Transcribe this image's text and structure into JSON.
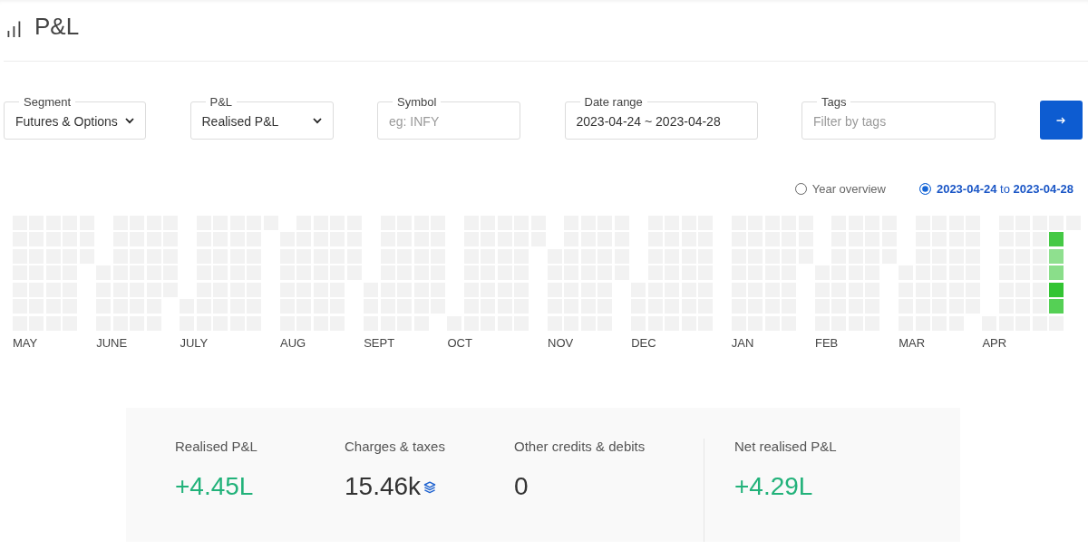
{
  "page": {
    "title": "P&L"
  },
  "filters": [
    {
      "kind": "select",
      "label": "Segment",
      "value": "Futures & Options"
    },
    {
      "kind": "select",
      "label": "P&L",
      "value": "Realised P&L"
    },
    {
      "kind": "input",
      "label": "Symbol",
      "placeholder": "eg: INFY"
    },
    {
      "kind": "input",
      "label": "Date range",
      "value": "2023-04-24 ~ 2023-04-28"
    },
    {
      "kind": "input",
      "label": "Tags",
      "placeholder": "Filter by tags"
    }
  ],
  "view_options": [
    {
      "label": "Year overview",
      "selected": false
    },
    {
      "label": "**2023-04-24** to **2023-04-28**",
      "selected": true
    }
  ],
  "heatmap": {
    "months": [
      {
        "label": "MAY",
        "days": [
          {
            "color": "#f2f2f2"
          },
          {
            "color": "#f2f2f2"
          },
          {
            "color": "#f2f2f2"
          },
          {
            "color": "#f2f2f2"
          },
          {
            "color": "#f2f2f2"
          },
          {
            "color": "#f2f2f2"
          },
          {
            "color": "#f2f2f2"
          },
          {
            "color": "#f2f2f2"
          },
          {
            "color": "#f2f2f2"
          },
          {
            "color": "#f2f2f2"
          },
          {
            "color": "#f2f2f2"
          },
          {
            "color": "#f2f2f2"
          },
          {
            "color": "#f2f2f2"
          },
          {
            "color": "#f2f2f2"
          },
          {
            "color": "#f2f2f2"
          },
          {
            "color": "#f2f2f2"
          },
          {
            "color": "#f2f2f2"
          },
          {
            "color": "#f2f2f2"
          },
          {
            "color": "#f2f2f2"
          },
          {
            "color": "#f2f2f2"
          },
          {
            "color": "#f2f2f2"
          },
          {
            "color": "#f2f2f2"
          },
          {
            "color": "#f2f2f2"
          },
          {
            "color": "#f2f2f2"
          },
          {
            "color": "#f2f2f2"
          },
          {
            "color": "#f2f2f2"
          },
          {
            "color": "#f2f2f2"
          },
          {
            "color": "#f2f2f2"
          },
          {
            "color": "#f2f2f2"
          },
          {
            "color": "#f2f2f2"
          },
          {
            "color": "#f2f2f2"
          }
        ]
      },
      {
        "label": "JUNE",
        "days": [
          {
            "color": "#f2f2f2"
          },
          {
            "color": "#f2f2f2"
          },
          {
            "color": "#f2f2f2"
          },
          {
            "color": "#f2f2f2"
          },
          {
            "color": "#f2f2f2"
          },
          {
            "color": "#f2f2f2"
          },
          {
            "color": "#f2f2f2"
          },
          {
            "color": "#f2f2f2"
          },
          {
            "color": "#f2f2f2"
          },
          {
            "color": "#f2f2f2"
          },
          {
            "color": "#f2f2f2"
          },
          {
            "color": "#f2f2f2"
          },
          {
            "color": "#f2f2f2"
          },
          {
            "color": "#f2f2f2"
          },
          {
            "color": "#f2f2f2"
          },
          {
            "color": "#f2f2f2"
          },
          {
            "color": "#f2f2f2"
          },
          {
            "color": "#f2f2f2"
          },
          {
            "color": "#f2f2f2"
          },
          {
            "color": "#f2f2f2"
          },
          {
            "color": "#f2f2f2"
          },
          {
            "color": "#f2f2f2"
          },
          {
            "color": "#f2f2f2"
          },
          {
            "color": "#f2f2f2"
          },
          {
            "color": "#f2f2f2"
          },
          {
            "color": "#f2f2f2"
          },
          {
            "color": "#f2f2f2"
          },
          {
            "color": "#f2f2f2"
          },
          {
            "color": "#f2f2f2"
          },
          {
            "color": "#f2f2f2"
          }
        ]
      },
      {
        "label": "JULY",
        "days": [
          {
            "color": "#f2f2f2"
          },
          {
            "color": "#f2f2f2"
          },
          {
            "color": "#f2f2f2"
          },
          {
            "color": "#f2f2f2"
          },
          {
            "color": "#f2f2f2"
          },
          {
            "color": "#f2f2f2"
          },
          {
            "color": "#f2f2f2"
          },
          {
            "color": "#f2f2f2"
          },
          {
            "color": "#f2f2f2"
          },
          {
            "color": "#f2f2f2"
          },
          {
            "color": "#f2f2f2"
          },
          {
            "color": "#f2f2f2"
          },
          {
            "color": "#f2f2f2"
          },
          {
            "color": "#f2f2f2"
          },
          {
            "color": "#f2f2f2"
          },
          {
            "color": "#f2f2f2"
          },
          {
            "color": "#f2f2f2"
          },
          {
            "color": "#f2f2f2"
          },
          {
            "color": "#f2f2f2"
          },
          {
            "color": "#f2f2f2"
          },
          {
            "color": "#f2f2f2"
          },
          {
            "color": "#f2f2f2"
          },
          {
            "color": "#f2f2f2"
          },
          {
            "color": "#f2f2f2"
          },
          {
            "color": "#f2f2f2"
          },
          {
            "color": "#f2f2f2"
          },
          {
            "color": "#f2f2f2"
          },
          {
            "color": "#f2f2f2"
          },
          {
            "color": "#f2f2f2"
          },
          {
            "color": "#f2f2f2"
          },
          {
            "color": "#f2f2f2"
          }
        ]
      },
      {
        "label": "AUG",
        "days": [
          {
            "color": "#f2f2f2"
          },
          {
            "color": "#f2f2f2"
          },
          {
            "color": "#f2f2f2"
          },
          {
            "color": "#f2f2f2"
          },
          {
            "color": "#f2f2f2"
          },
          {
            "color": "#f2f2f2"
          },
          {
            "color": "#f2f2f2"
          },
          {
            "color": "#f2f2f2"
          },
          {
            "color": "#f2f2f2"
          },
          {
            "color": "#f2f2f2"
          },
          {
            "color": "#f2f2f2"
          },
          {
            "color": "#f2f2f2"
          },
          {
            "color": "#f2f2f2"
          },
          {
            "color": "#f2f2f2"
          },
          {
            "color": "#f2f2f2"
          },
          {
            "color": "#f2f2f2"
          },
          {
            "color": "#f2f2f2"
          },
          {
            "color": "#f2f2f2"
          },
          {
            "color": "#f2f2f2"
          },
          {
            "color": "#f2f2f2"
          },
          {
            "color": "#f2f2f2"
          },
          {
            "color": "#f2f2f2"
          },
          {
            "color": "#f2f2f2"
          },
          {
            "color": "#f2f2f2"
          },
          {
            "color": "#f2f2f2"
          },
          {
            "color": "#f2f2f2"
          },
          {
            "color": "#f2f2f2"
          },
          {
            "color": "#f2f2f2"
          },
          {
            "color": "#f2f2f2"
          },
          {
            "color": "#f2f2f2"
          },
          {
            "color": "#f2f2f2"
          }
        ]
      },
      {
        "label": "SEPT",
        "days": [
          {
            "color": "#f2f2f2"
          },
          {
            "color": "#f2f2f2"
          },
          {
            "color": "#f2f2f2"
          },
          {
            "color": "#f2f2f2"
          },
          {
            "color": "#f2f2f2"
          },
          {
            "color": "#f2f2f2"
          },
          {
            "color": "#f2f2f2"
          },
          {
            "color": "#f2f2f2"
          },
          {
            "color": "#f2f2f2"
          },
          {
            "color": "#f2f2f2"
          },
          {
            "color": "#f2f2f2"
          },
          {
            "color": "#f2f2f2"
          },
          {
            "color": "#f2f2f2"
          },
          {
            "color": "#f2f2f2"
          },
          {
            "color": "#f2f2f2"
          },
          {
            "color": "#f2f2f2"
          },
          {
            "color": "#f2f2f2"
          },
          {
            "color": "#f2f2f2"
          },
          {
            "color": "#f2f2f2"
          },
          {
            "color": "#f2f2f2"
          },
          {
            "color": "#f2f2f2"
          },
          {
            "color": "#f2f2f2"
          },
          {
            "color": "#f2f2f2"
          },
          {
            "color": "#f2f2f2"
          },
          {
            "color": "#f2f2f2"
          },
          {
            "color": "#f2f2f2"
          },
          {
            "color": "#f2f2f2"
          },
          {
            "color": "#f2f2f2"
          },
          {
            "color": "#f2f2f2"
          },
          {
            "color": "#f2f2f2"
          }
        ]
      },
      {
        "label": "OCT",
        "days": [
          {
            "color": "#f2f2f2"
          },
          {
            "color": "#f2f2f2"
          },
          {
            "color": "#f2f2f2"
          },
          {
            "color": "#f2f2f2"
          },
          {
            "color": "#f2f2f2"
          },
          {
            "color": "#f2f2f2"
          },
          {
            "color": "#f2f2f2"
          },
          {
            "color": "#f2f2f2"
          },
          {
            "color": "#f2f2f2"
          },
          {
            "color": "#f2f2f2"
          },
          {
            "color": "#f2f2f2"
          },
          {
            "color": "#f2f2f2"
          },
          {
            "color": "#f2f2f2"
          },
          {
            "color": "#f2f2f2"
          },
          {
            "color": "#f2f2f2"
          },
          {
            "color": "#f2f2f2"
          },
          {
            "color": "#f2f2f2"
          },
          {
            "color": "#f2f2f2"
          },
          {
            "color": "#f2f2f2"
          },
          {
            "color": "#f2f2f2"
          },
          {
            "color": "#f2f2f2"
          },
          {
            "color": "#f2f2f2"
          },
          {
            "color": "#f2f2f2"
          },
          {
            "color": "#f2f2f2"
          },
          {
            "color": "#f2f2f2"
          },
          {
            "color": "#f2f2f2"
          },
          {
            "color": "#f2f2f2"
          },
          {
            "color": "#f2f2f2"
          },
          {
            "color": "#f2f2f2"
          },
          {
            "color": "#f2f2f2"
          },
          {
            "color": "#f2f2f2"
          }
        ]
      },
      {
        "label": "NOV",
        "days": [
          {
            "color": "#f2f2f2"
          },
          {
            "color": "#f2f2f2"
          },
          {
            "color": "#f2f2f2"
          },
          {
            "color": "#f2f2f2"
          },
          {
            "color": "#f2f2f2"
          },
          {
            "color": "#f2f2f2"
          },
          {
            "color": "#f2f2f2"
          },
          {
            "color": "#f2f2f2"
          },
          {
            "color": "#f2f2f2"
          },
          {
            "color": "#f2f2f2"
          },
          {
            "color": "#f2f2f2"
          },
          {
            "color": "#f2f2f2"
          },
          {
            "color": "#f2f2f2"
          },
          {
            "color": "#f2f2f2"
          },
          {
            "color": "#f2f2f2"
          },
          {
            "color": "#f2f2f2"
          },
          {
            "color": "#f2f2f2"
          },
          {
            "color": "#f2f2f2"
          },
          {
            "color": "#f2f2f2"
          },
          {
            "color": "#f2f2f2"
          },
          {
            "color": "#f2f2f2"
          },
          {
            "color": "#f2f2f2"
          },
          {
            "color": "#f2f2f2"
          },
          {
            "color": "#f2f2f2"
          },
          {
            "color": "#f2f2f2"
          },
          {
            "color": "#f2f2f2"
          },
          {
            "color": "#f2f2f2"
          },
          {
            "color": "#f2f2f2"
          },
          {
            "color": "#f2f2f2"
          },
          {
            "color": "#f2f2f2"
          }
        ]
      },
      {
        "label": "DEC",
        "days": [
          {
            "color": "#f2f2f2"
          },
          {
            "color": "#f2f2f2"
          },
          {
            "color": "#f2f2f2"
          },
          {
            "color": "#f2f2f2"
          },
          {
            "color": "#f2f2f2"
          },
          {
            "color": "#f2f2f2"
          },
          {
            "color": "#f2f2f2"
          },
          {
            "color": "#f2f2f2"
          },
          {
            "color": "#f2f2f2"
          },
          {
            "color": "#f2f2f2"
          },
          {
            "color": "#f2f2f2"
          },
          {
            "color": "#f2f2f2"
          },
          {
            "color": "#f2f2f2"
          },
          {
            "color": "#f2f2f2"
          },
          {
            "color": "#f2f2f2"
          },
          {
            "color": "#f2f2f2"
          },
          {
            "color": "#f2f2f2"
          },
          {
            "color": "#f2f2f2"
          },
          {
            "color": "#f2f2f2"
          },
          {
            "color": "#f2f2f2"
          },
          {
            "color": "#f2f2f2"
          },
          {
            "color": "#f2f2f2"
          },
          {
            "color": "#f2f2f2"
          },
          {
            "color": "#f2f2f2"
          },
          {
            "color": "#f2f2f2"
          },
          {
            "color": "#f2f2f2"
          },
          {
            "color": "#f2f2f2"
          },
          {
            "color": "#f2f2f2"
          },
          {
            "color": "#f2f2f2"
          },
          {
            "color": "#f2f2f2"
          },
          {
            "color": "#f2f2f2"
          }
        ]
      },
      {
        "label": "JAN",
        "days": [
          {
            "color": "#f2f2f2"
          },
          {
            "color": "#f2f2f2"
          },
          {
            "color": "#f2f2f2"
          },
          {
            "color": "#f2f2f2"
          },
          {
            "color": "#f2f2f2"
          },
          {
            "color": "#f2f2f2"
          },
          {
            "color": "#f2f2f2"
          },
          {
            "color": "#f2f2f2"
          },
          {
            "color": "#f2f2f2"
          },
          {
            "color": "#f2f2f2"
          },
          {
            "color": "#f2f2f2"
          },
          {
            "color": "#f2f2f2"
          },
          {
            "color": "#f2f2f2"
          },
          {
            "color": "#f2f2f2"
          },
          {
            "color": "#f2f2f2"
          },
          {
            "color": "#f2f2f2"
          },
          {
            "color": "#f2f2f2"
          },
          {
            "color": "#f2f2f2"
          },
          {
            "color": "#f2f2f2"
          },
          {
            "color": "#f2f2f2"
          },
          {
            "color": "#f2f2f2"
          },
          {
            "color": "#f2f2f2"
          },
          {
            "color": "#f2f2f2"
          },
          {
            "color": "#f2f2f2"
          },
          {
            "color": "#f2f2f2"
          },
          {
            "color": "#f2f2f2"
          },
          {
            "color": "#f2f2f2"
          },
          {
            "color": "#f2f2f2"
          },
          {
            "color": "#f2f2f2"
          },
          {
            "color": "#f2f2f2"
          },
          {
            "color": "#f2f2f2"
          }
        ]
      },
      {
        "label": "FEB",
        "days": [
          {
            "color": "#f2f2f2"
          },
          {
            "color": "#f2f2f2"
          },
          {
            "color": "#f2f2f2"
          },
          {
            "color": "#f2f2f2"
          },
          {
            "color": "#f2f2f2"
          },
          {
            "color": "#f2f2f2"
          },
          {
            "color": "#f2f2f2"
          },
          {
            "color": "#f2f2f2"
          },
          {
            "color": "#f2f2f2"
          },
          {
            "color": "#f2f2f2"
          },
          {
            "color": "#f2f2f2"
          },
          {
            "color": "#f2f2f2"
          },
          {
            "color": "#f2f2f2"
          },
          {
            "color": "#f2f2f2"
          },
          {
            "color": "#f2f2f2"
          },
          {
            "color": "#f2f2f2"
          },
          {
            "color": "#f2f2f2"
          },
          {
            "color": "#f2f2f2"
          },
          {
            "color": "#f2f2f2"
          },
          {
            "color": "#f2f2f2"
          },
          {
            "color": "#f2f2f2"
          },
          {
            "color": "#f2f2f2"
          },
          {
            "color": "#f2f2f2"
          },
          {
            "color": "#f2f2f2"
          },
          {
            "color": "#f2f2f2"
          },
          {
            "color": "#f2f2f2"
          },
          {
            "color": "#f2f2f2"
          },
          {
            "color": "#f2f2f2"
          }
        ]
      },
      {
        "label": "MAR",
        "days": [
          {
            "color": "#f2f2f2"
          },
          {
            "color": "#f2f2f2"
          },
          {
            "color": "#f2f2f2"
          },
          {
            "color": "#f2f2f2"
          },
          {
            "color": "#f2f2f2"
          },
          {
            "color": "#f2f2f2"
          },
          {
            "color": "#f2f2f2"
          },
          {
            "color": "#f2f2f2"
          },
          {
            "color": "#f2f2f2"
          },
          {
            "color": "#f2f2f2"
          },
          {
            "color": "#f2f2f2"
          },
          {
            "color": "#f2f2f2"
          },
          {
            "color": "#f2f2f2"
          },
          {
            "color": "#f2f2f2"
          },
          {
            "color": "#f2f2f2"
          },
          {
            "color": "#f2f2f2"
          },
          {
            "color": "#f2f2f2"
          },
          {
            "color": "#f2f2f2"
          },
          {
            "color": "#f2f2f2"
          },
          {
            "color": "#f2f2f2"
          },
          {
            "color": "#f2f2f2"
          },
          {
            "color": "#f2f2f2"
          },
          {
            "color": "#f2f2f2"
          },
          {
            "color": "#f2f2f2"
          },
          {
            "color": "#f2f2f2"
          },
          {
            "color": "#f2f2f2"
          },
          {
            "color": "#f2f2f2"
          },
          {
            "color": "#f2f2f2"
          },
          {
            "color": "#f2f2f2"
          },
          {
            "color": "#f2f2f2"
          },
          {
            "color": "#f2f2f2"
          }
        ]
      },
      {
        "label": "APR",
        "days": [
          {
            "color": "#f2f2f2"
          },
          {
            "color": "#f2f2f2"
          },
          {
            "color": "#f2f2f2"
          },
          {
            "color": "#f2f2f2"
          },
          {
            "color": "#f2f2f2"
          },
          {
            "color": "#f2f2f2"
          },
          {
            "color": "#f2f2f2"
          },
          {
            "color": "#f2f2f2"
          },
          {
            "color": "#f2f2f2"
          },
          {
            "color": "#f2f2f2"
          },
          {
            "color": "#f2f2f2"
          },
          {
            "color": "#f2f2f2"
          },
          {
            "color": "#f2f2f2"
          },
          {
            "color": "#f2f2f2"
          },
          {
            "color": "#f2f2f2"
          },
          {
            "color": "#f2f2f2"
          },
          {
            "color": "#f2f2f2"
          },
          {
            "color": "#f2f2f2"
          },
          {
            "color": "#f2f2f2"
          },
          {
            "color": "#f2f2f2"
          },
          {
            "color": "#f2f2f2"
          },
          {
            "color": "#f2f2f2"
          },
          {
            "color": "#f2f2f2"
          },
          {
            "color": "#45c945"
          },
          {
            "color": "#8fe08f"
          },
          {
            "color": "#8ade8a"
          },
          {
            "color": "#33c433"
          },
          {
            "color": "#55d055"
          },
          {
            "color": "#f2f2f2"
          },
          {
            "color": "#f2f2f2"
          }
        ]
      }
    ]
  },
  "summary": [
    {
      "kind": "component",
      "label": "Realised P&L",
      "value": "+4.45L",
      "gain": true,
      "has_breakdown": false
    },
    {
      "kind": "component",
      "label": "Charges & taxes",
      "value": "15.46k",
      "gain": false,
      "has_breakdown": true
    },
    {
      "kind": "component",
      "label": "Other credits & debits",
      "value": "0",
      "gain": false,
      "has_breakdown": false
    },
    {
      "kind": "total",
      "label": "Net realised P&L",
      "value": "+4.29L",
      "gain": true,
      "has_breakdown": false
    }
  ]
}
